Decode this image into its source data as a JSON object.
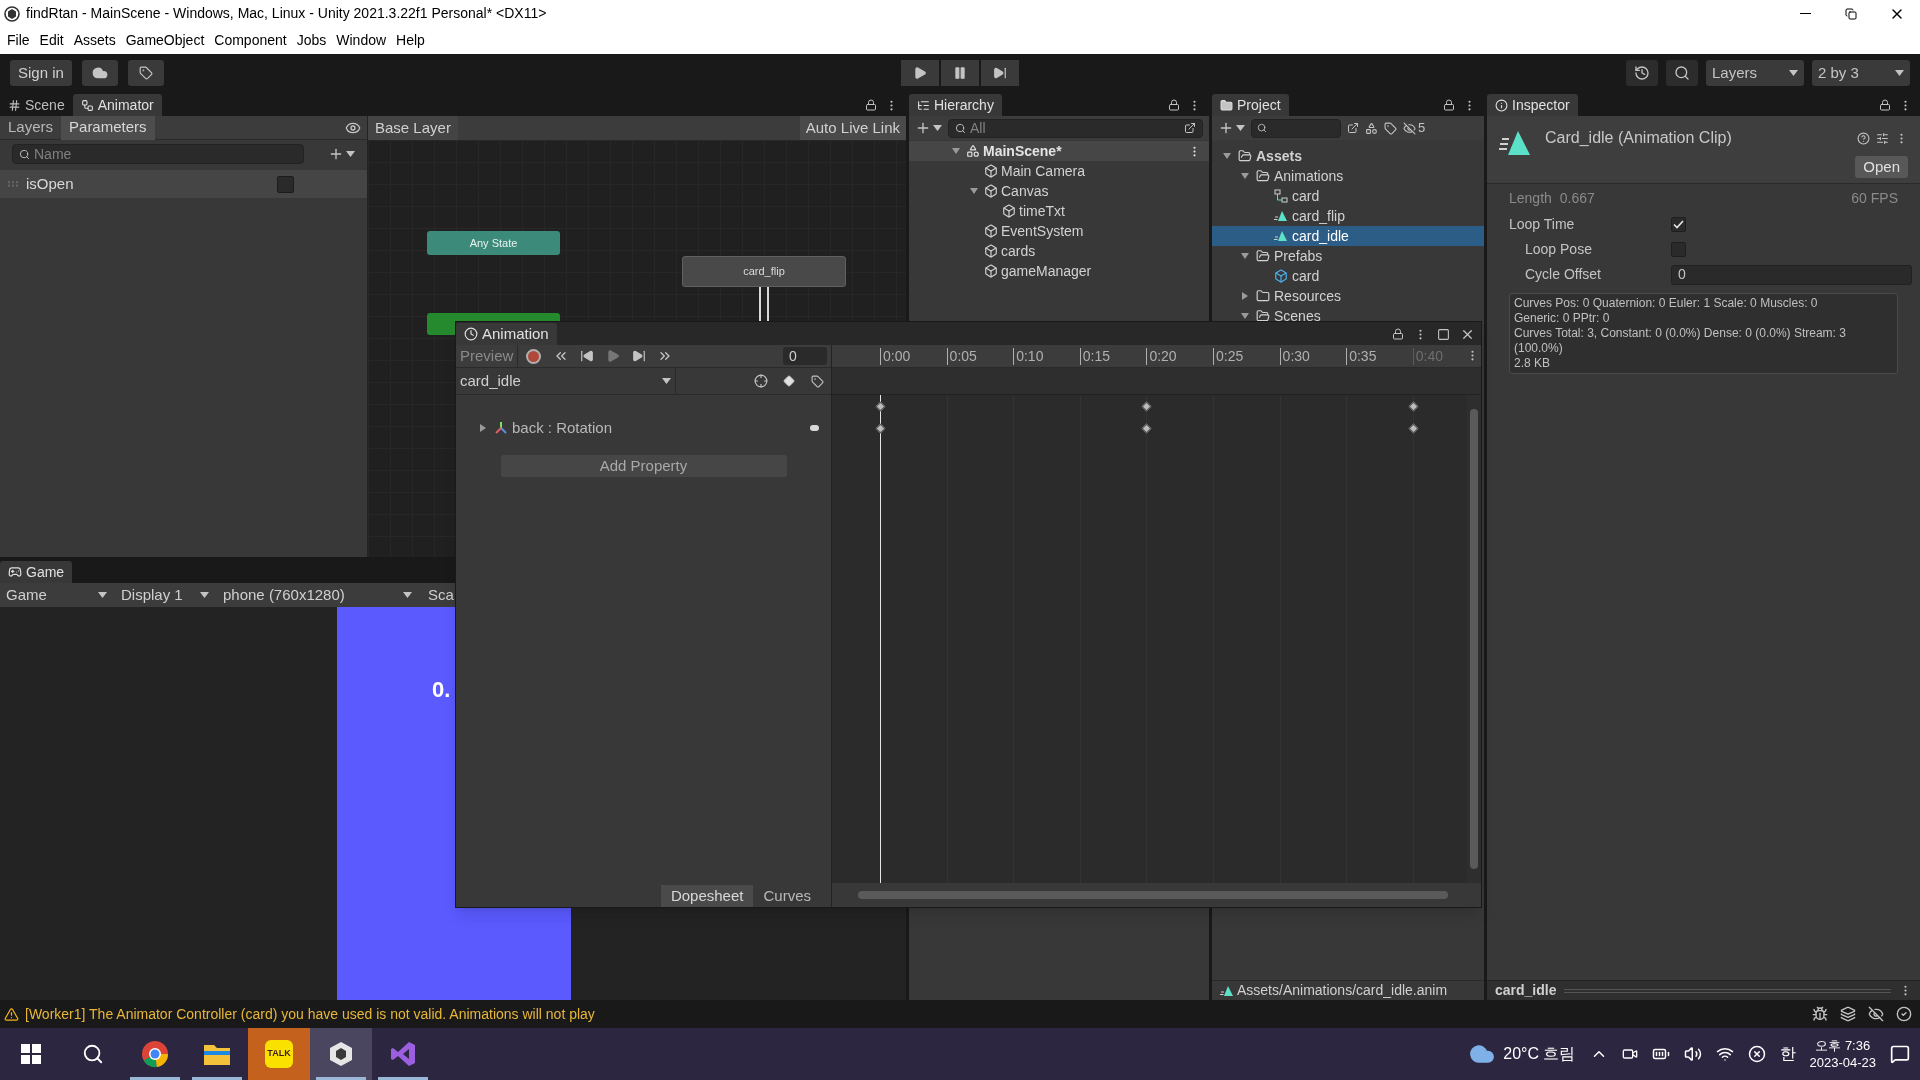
{
  "window": {
    "title": "findRtan - MainScene - Windows, Mac, Linux - Unity 2021.3.22f1 Personal* <DX11>"
  },
  "menu": [
    "File",
    "Edit",
    "Assets",
    "GameObject",
    "Component",
    "Jobs",
    "Window",
    "Help"
  ],
  "toolbar": {
    "sign_in": "Sign in",
    "layers": "Layers",
    "layout": "2 by 3"
  },
  "animator": {
    "tabs": [
      {
        "label": "Scene",
        "selected": false
      },
      {
        "label": "Animator",
        "selected": true
      }
    ],
    "sub_tabs": [
      {
        "label": "Layers",
        "selected": false
      },
      {
        "label": "Parameters",
        "selected": true
      }
    ],
    "search": {
      "placeholder": "Name"
    },
    "parameters": [
      {
        "name": "isOpen",
        "checked": false
      }
    ],
    "breadcrumb": "Base Layer",
    "live_link": "Auto Live Link",
    "nodes": [
      {
        "label": "Any State",
        "kind": "any"
      },
      {
        "label": "card_flip",
        "kind": "state"
      },
      {
        "kind": "default"
      }
    ]
  },
  "game": {
    "tab": "Game",
    "controls": [
      {
        "label": "Game",
        "kind": "dropdown"
      },
      {
        "label": "Display 1",
        "kind": "dropdown"
      },
      {
        "label": "phone (760x1280)",
        "kind": "dropdown"
      },
      {
        "label": "Sca",
        "kind": "field"
      }
    ],
    "overlay_text": "0."
  },
  "hierarchy": {
    "tab": "Hierarchy",
    "search": {
      "placeholder": "All"
    },
    "tree": [
      {
        "label": "MainScene*",
        "kind": "scene",
        "expanded": true,
        "children": [
          {
            "label": "Main Camera",
            "kind": "object"
          },
          {
            "label": "Canvas",
            "kind": "object",
            "expanded": true,
            "children": [
              {
                "label": "timeTxt",
                "kind": "object"
              }
            ]
          },
          {
            "label": "EventSystem",
            "kind": "object"
          },
          {
            "label": "cards",
            "kind": "object"
          },
          {
            "label": "gameManager",
            "kind": "object"
          }
        ]
      }
    ]
  },
  "project": {
    "tab": "Project",
    "hidden_count": "5",
    "tree": [
      {
        "label": "Assets",
        "kind": "folder",
        "expanded": true,
        "selected": false,
        "children": [
          {
            "label": "Animations",
            "kind": "folder",
            "expanded": true,
            "selected": false,
            "children": [
              {
                "label": "card",
                "kind": "controller",
                "selected": false
              },
              {
                "label": "card_flip",
                "kind": "clip",
                "selected": false
              },
              {
                "label": "card_idle",
                "kind": "clip",
                "selected": true
              }
            ]
          },
          {
            "label": "Prefabs",
            "kind": "folder",
            "expanded": true,
            "selected": false,
            "children": [
              {
                "label": "card",
                "kind": "prefab",
                "selected": false
              }
            ]
          },
          {
            "label": "Resources",
            "kind": "folder",
            "expanded": false,
            "selected": false
          },
          {
            "label": "Scenes",
            "kind": "folder",
            "expanded": true,
            "selected": false
          }
        ]
      }
    ],
    "path": "Assets/Animations/card_idle.anim"
  },
  "inspector": {
    "tab": "Inspector",
    "title": "Card_idle (Animation Clip)",
    "open": "Open",
    "length_label": "Length",
    "length": "0.667",
    "fps": "60 FPS",
    "fields": [
      {
        "label": "Loop Time",
        "kind": "checkbox",
        "checked": true,
        "children": [
          {
            "label": "Loop Pose",
            "kind": "checkbox",
            "checked": false
          },
          {
            "label": "Cycle Offset",
            "kind": "number",
            "value": "0"
          }
        ]
      }
    ],
    "info": [
      "Curves Pos: 0 Quaternion: 0 Euler: 1 Scale: 0 Muscles: 0",
      "Generic: 0 PPtr: 0",
      "Curves Total: 3, Constant: 0 (0.0%) Dense: 0 (0.0%) Stream: 3 (100.0%)",
      "2.8 KB"
    ],
    "preview": "card_idle"
  },
  "animation": {
    "tab": "Animation",
    "preview": "Preview",
    "recording": false,
    "frame": "0",
    "clip": "card_idle",
    "ticks": [
      {
        "label": "0:00",
        "dim": false,
        "keyframe": true
      },
      {
        "label": "0:05",
        "dim": false,
        "keyframe": false
      },
      {
        "label": "0:10",
        "dim": false,
        "keyframe": false
      },
      {
        "label": "0:15",
        "dim": false,
        "keyframe": false
      },
      {
        "label": "0:20",
        "dim": false,
        "keyframe": true
      },
      {
        "label": "0:25",
        "dim": false,
        "keyframe": false
      },
      {
        "label": "0:30",
        "dim": false,
        "keyframe": false
      },
      {
        "label": "0:35",
        "dim": false,
        "keyframe": false
      },
      {
        "label": "0:40",
        "dim": true,
        "keyframe": true
      }
    ],
    "properties": [
      {
        "label": "back : Rotation",
        "expanded": false
      }
    ],
    "add_property": "Add Property",
    "views": [
      {
        "label": "Dopesheet",
        "selected": true
      },
      {
        "label": "Curves",
        "selected": false
      }
    ]
  },
  "status": {
    "message": "[Worker1] The Animator Controller (card) you have used is not valid. Animations will not play"
  },
  "taskbar": {
    "apps": [
      {
        "kind": "start",
        "selected": false,
        "running": false,
        "flashing": false
      },
      {
        "kind": "search",
        "selected": false,
        "running": false,
        "flashing": false
      },
      {
        "kind": "browser",
        "selected": false,
        "running": true,
        "flashing": false
      },
      {
        "kind": "files",
        "selected": false,
        "running": true,
        "flashing": false
      },
      {
        "kind": "chat",
        "selected": false,
        "running": false,
        "flashing": true,
        "label": "TALK"
      },
      {
        "kind": "unity",
        "selected": true,
        "running": true,
        "flashing": false
      },
      {
        "kind": "ide",
        "selected": false,
        "running": true,
        "flashing": false
      }
    ],
    "weather": "20°C 흐림",
    "ime": "한",
    "time": "오후 7:36",
    "date": "2023-04-23"
  }
}
